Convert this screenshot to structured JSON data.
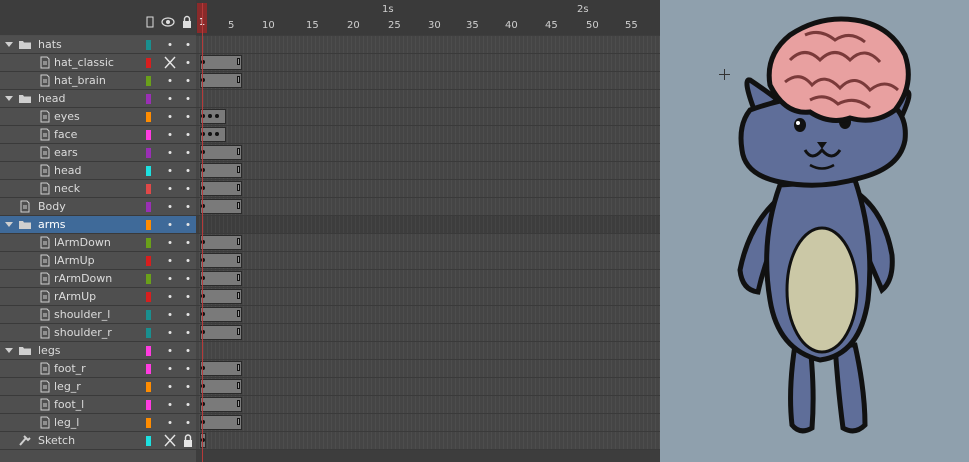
{
  "layers": [
    {
      "name": "hats",
      "type": "folder",
      "indent": 0,
      "color": "#1a8f8f",
      "expanded": true,
      "visible": "dot",
      "locked": "dot"
    },
    {
      "name": "hat_classic",
      "type": "layer",
      "indent": 1,
      "color": "#d81e1e",
      "visible": "hidden",
      "locked": "dot"
    },
    {
      "name": "hat_brain",
      "type": "layer",
      "indent": 1,
      "color": "#6aa01a",
      "visible": "dot",
      "locked": "dot"
    },
    {
      "name": "head",
      "type": "folder",
      "indent": 0,
      "color": "#9a2fb5",
      "expanded": true,
      "visible": "dot",
      "locked": "dot"
    },
    {
      "name": "eyes",
      "type": "layer",
      "indent": 1,
      "color": "#ff8c00",
      "visible": "dot",
      "locked": "dot"
    },
    {
      "name": "face",
      "type": "layer",
      "indent": 1,
      "color": "#ff3ce0",
      "visible": "dot",
      "locked": "dot"
    },
    {
      "name": "ears",
      "type": "layer",
      "indent": 1,
      "color": "#9a2fb5",
      "visible": "dot",
      "locked": "dot"
    },
    {
      "name": "head",
      "type": "layer",
      "indent": 1,
      "color": "#1ee0e0",
      "visible": "dot",
      "locked": "dot"
    },
    {
      "name": "neck",
      "type": "layer",
      "indent": 1,
      "color": "#e04848",
      "visible": "dot",
      "locked": "dot"
    },
    {
      "name": "Body",
      "type": "layer",
      "indent": 0,
      "color": "#9a2fb5",
      "visible": "dot",
      "locked": "dot"
    },
    {
      "name": "arms",
      "type": "folder",
      "indent": 0,
      "color": "#ff8c00",
      "expanded": true,
      "visible": "dot",
      "locked": "dot",
      "selected": true
    },
    {
      "name": "lArmDown",
      "type": "layer",
      "indent": 1,
      "color": "#6aa01a",
      "visible": "dot",
      "locked": "dot"
    },
    {
      "name": "lArmUp",
      "type": "layer",
      "indent": 1,
      "color": "#d81e1e",
      "visible": "dot",
      "locked": "dot"
    },
    {
      "name": "rArmDown",
      "type": "layer",
      "indent": 1,
      "color": "#6aa01a",
      "visible": "dot",
      "locked": "dot"
    },
    {
      "name": "rArmUp",
      "type": "layer",
      "indent": 1,
      "color": "#d81e1e",
      "visible": "dot",
      "locked": "dot"
    },
    {
      "name": "shoulder_l",
      "type": "layer",
      "indent": 1,
      "color": "#1a8f8f",
      "visible": "dot",
      "locked": "dot"
    },
    {
      "name": "shoulder_r",
      "type": "layer",
      "indent": 1,
      "color": "#1a8f8f",
      "visible": "dot",
      "locked": "dot"
    },
    {
      "name": "legs",
      "type": "folder",
      "indent": 0,
      "color": "#ff3ce0",
      "expanded": true,
      "visible": "dot",
      "locked": "dot"
    },
    {
      "name": "foot_r",
      "type": "layer",
      "indent": 1,
      "color": "#ff3ce0",
      "visible": "dot",
      "locked": "dot"
    },
    {
      "name": "leg_r",
      "type": "layer",
      "indent": 1,
      "color": "#ff8c00",
      "visible": "dot",
      "locked": "dot"
    },
    {
      "name": "foot_l",
      "type": "layer",
      "indent": 1,
      "color": "#ff3ce0",
      "visible": "dot",
      "locked": "dot"
    },
    {
      "name": "leg_l",
      "type": "layer",
      "indent": 1,
      "color": "#ff8c00",
      "visible": "dot",
      "locked": "dot"
    },
    {
      "name": "Sketch",
      "type": "guide",
      "indent": 0,
      "color": "#1ee0e0",
      "visible": "hidden",
      "locked": "locked"
    }
  ],
  "ruler": {
    "frame_labels": [
      "1",
      "5",
      "10",
      "15",
      "20",
      "25",
      "30",
      "35",
      "40",
      "45",
      "50",
      "55"
    ],
    "second_labels": [
      "1s",
      "2s"
    ]
  },
  "frames": [
    {
      "keyframes": [],
      "span": null
    },
    {
      "keyframes": [
        1
      ],
      "span": [
        1,
        10
      ]
    },
    {
      "keyframes": [
        1
      ],
      "span": [
        1,
        10
      ]
    },
    {
      "keyframes": [],
      "span": null
    },
    {
      "keyframes": [
        1,
        2,
        3
      ],
      "span": [
        1,
        6
      ]
    },
    {
      "keyframes": [
        1,
        2,
        3
      ],
      "span": [
        1,
        6
      ]
    },
    {
      "keyframes": [
        1
      ],
      "span": [
        1,
        10
      ]
    },
    {
      "keyframes": [
        1
      ],
      "span": [
        1,
        10
      ]
    },
    {
      "keyframes": [
        1
      ],
      "span": [
        1,
        10
      ]
    },
    {
      "keyframes": [
        1
      ],
      "span": [
        1,
        10
      ]
    },
    {
      "keyframes": [],
      "span": null
    },
    {
      "keyframes": [
        1
      ],
      "span": [
        1,
        10
      ]
    },
    {
      "keyframes": [
        1
      ],
      "span": [
        1,
        10
      ]
    },
    {
      "keyframes": [
        1
      ],
      "span": [
        1,
        10
      ]
    },
    {
      "keyframes": [
        1
      ],
      "span": [
        1,
        10
      ]
    },
    {
      "keyframes": [
        1
      ],
      "span": [
        1,
        10
      ]
    },
    {
      "keyframes": [
        1
      ],
      "span": [
        1,
        10
      ]
    },
    {
      "keyframes": [],
      "span": null
    },
    {
      "keyframes": [
        1
      ],
      "span": [
        1,
        10
      ]
    },
    {
      "keyframes": [
        1
      ],
      "span": [
        1,
        10
      ]
    },
    {
      "keyframes": [
        1
      ],
      "span": [
        1,
        10
      ]
    },
    {
      "keyframes": [
        1
      ],
      "span": [
        1,
        10
      ]
    },
    {
      "keyframes": [
        1
      ],
      "span": [
        1,
        1
      ]
    }
  ],
  "playhead": {
    "frame": 1
  },
  "header_icons": [
    "outline-icon",
    "eye-icon",
    "lock-icon"
  ],
  "stage": {
    "background": "#8fa0ad",
    "character": "blue cat wearing brain hat"
  }
}
